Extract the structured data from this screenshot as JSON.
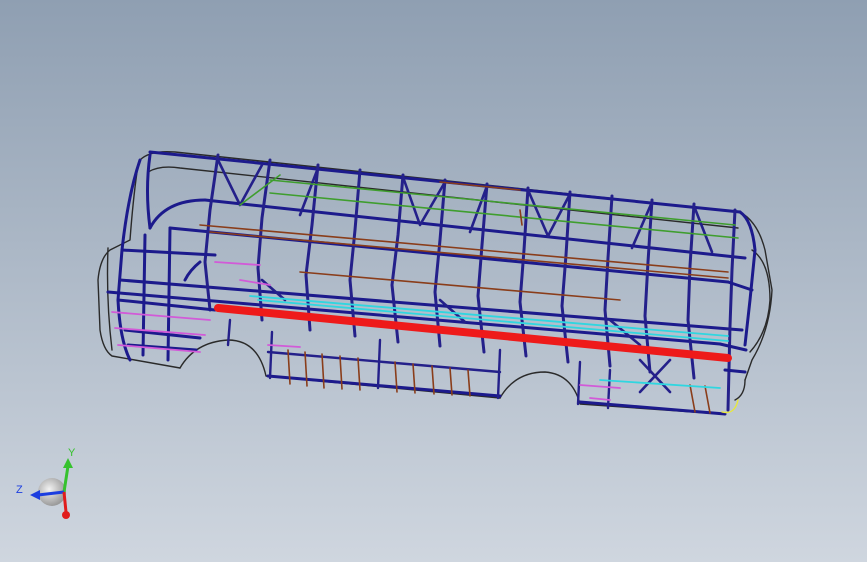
{
  "viewport": {
    "background_top": "#8f9fb2",
    "background_bottom": "#cfd6df"
  },
  "model": {
    "frame_color": "#1c1a8c",
    "rib_color": "#24208a",
    "outline_color": "#2a2a2a",
    "floor_beam_color": "#ee1a1a",
    "green_tube_color": "#3f9e2e",
    "brown_tube_color": "#8a3d1a",
    "cyan_tube_color": "#2fd6e0",
    "pink_tube_color": "#d25ad8",
    "yellow_wire_color": "#e8e83a"
  },
  "triad": {
    "y_label": "Y",
    "z_label": "Z",
    "x_color": "#e01c1c",
    "y_color": "#36c22e",
    "z_color": "#1c3ee0"
  }
}
